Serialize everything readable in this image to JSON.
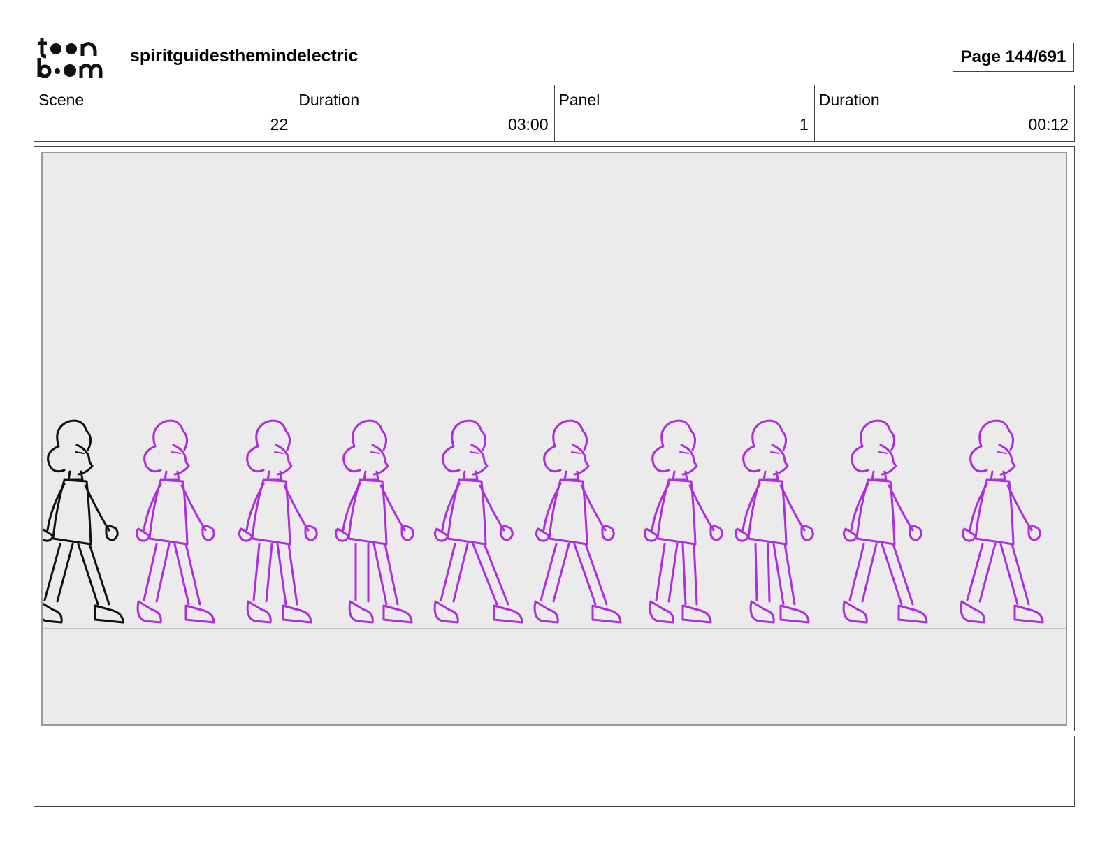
{
  "header": {
    "logo_text": "toon boom",
    "project_title": "spiritguidesthemindelectric",
    "page_label": "Page 144/691"
  },
  "info": {
    "scene_label": "Scene",
    "scene_value": "22",
    "scene_duration_label": "Duration",
    "scene_duration_value": "03:00",
    "panel_label": "Panel",
    "panel_value": "1",
    "panel_duration_label": "Duration",
    "panel_duration_value": "00:12"
  },
  "panel": {
    "drawing": "walk-cycle-sketch",
    "ink_colors": {
      "main": "#111111",
      "onion_skin": "#b02ce0"
    },
    "background_color": "#ebebeb",
    "frame_count": 10
  },
  "caption": {
    "text": ""
  }
}
